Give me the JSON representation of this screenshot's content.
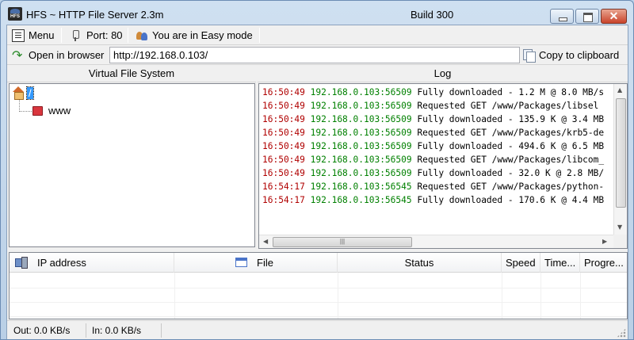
{
  "window": {
    "app_icon_text": "HFS",
    "title": "HFS ~ HTTP File Server 2.3m",
    "build": "Build 300",
    "close_glyph": "✕"
  },
  "toolbar": {
    "menu_label": "Menu",
    "port_label": "Port: 80",
    "mode_label": "You are in Easy mode"
  },
  "urlbar": {
    "open_label": "Open in browser",
    "url_value": "http://192.168.0.103/",
    "copy_label": "Copy to clipboard"
  },
  "vfs": {
    "header": "Virtual File System",
    "root_label": "/",
    "items": [
      {
        "label": "www"
      }
    ]
  },
  "log": {
    "header": "Log",
    "entries": [
      {
        "time": "16:50:49",
        "ip": "192.168.0.103:56509",
        "msg": "Fully downloaded - 1.2 M @ 8.0 MB/s"
      },
      {
        "time": "16:50:49",
        "ip": "192.168.0.103:56509",
        "msg": "Requested GET /www/Packages/libsel"
      },
      {
        "time": "16:50:49",
        "ip": "192.168.0.103:56509",
        "msg": "Fully downloaded - 135.9 K @ 3.4 MB"
      },
      {
        "time": "16:50:49",
        "ip": "192.168.0.103:56509",
        "msg": "Requested GET /www/Packages/krb5-de"
      },
      {
        "time": "16:50:49",
        "ip": "192.168.0.103:56509",
        "msg": "Fully downloaded - 494.6 K @ 6.5 MB"
      },
      {
        "time": "16:50:49",
        "ip": "192.168.0.103:56509",
        "msg": "Requested GET /www/Packages/libcom_"
      },
      {
        "time": "16:50:49",
        "ip": "192.168.0.103:56509",
        "msg": "Fully downloaded - 32.0 K @ 2.8 MB/"
      },
      {
        "time": "16:54:17",
        "ip": "192.168.0.103:56545",
        "msg": "Requested GET /www/Packages/python-"
      },
      {
        "time": "16:54:17",
        "ip": "192.168.0.103:56545",
        "msg": "Fully downloaded - 170.6 K @ 4.4 MB"
      }
    ]
  },
  "connections": {
    "columns": [
      "IP address",
      "File",
      "Status",
      "Speed",
      "Time...",
      "Progre..."
    ]
  },
  "statusbar": {
    "out": "Out: 0.0 KB/s",
    "in": "In: 0.0 KB/s"
  }
}
